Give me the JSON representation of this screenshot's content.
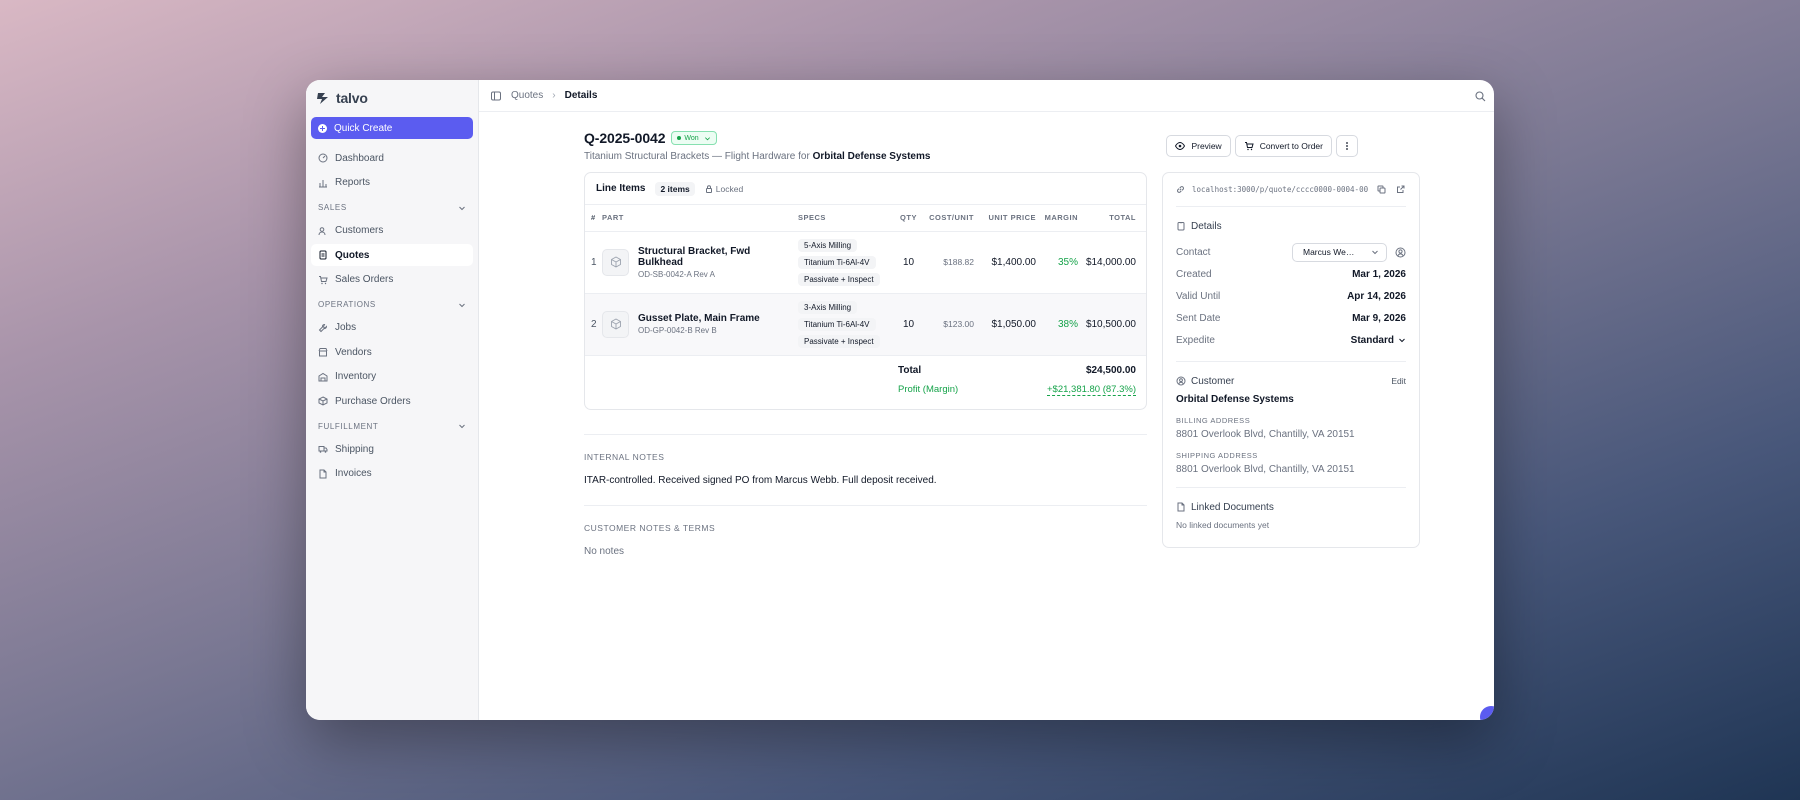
{
  "app": {
    "name": "talvo"
  },
  "sidebar": {
    "quick_create": "Quick Create",
    "top_items": [
      {
        "label": "Dashboard",
        "icon": "dashboard-icon"
      },
      {
        "label": "Reports",
        "icon": "bar-chart-icon"
      }
    ],
    "sections": [
      {
        "title": "SALES",
        "items": [
          {
            "label": "Customers",
            "icon": "users-icon"
          },
          {
            "label": "Quotes",
            "icon": "document-icon",
            "active": true
          },
          {
            "label": "Sales Orders",
            "icon": "cart-icon"
          }
        ]
      },
      {
        "title": "OPERATIONS",
        "items": [
          {
            "label": "Jobs",
            "icon": "wrench-icon"
          },
          {
            "label": "Vendors",
            "icon": "store-icon"
          },
          {
            "label": "Inventory",
            "icon": "warehouse-icon"
          },
          {
            "label": "Purchase Orders",
            "icon": "package-icon"
          }
        ]
      },
      {
        "title": "FULFILLMENT",
        "items": [
          {
            "label": "Shipping",
            "icon": "truck-icon"
          },
          {
            "label": "Invoices",
            "icon": "file-icon"
          }
        ]
      }
    ]
  },
  "breadcrumb": {
    "parent": "Quotes",
    "current": "Details"
  },
  "quote": {
    "id": "Q-2025-0042",
    "status": "Won",
    "subtitle_prefix": "Titanium Structural Brackets — Flight Hardware for",
    "customer": "Orbital Defense Systems"
  },
  "actions": {
    "preview": "Preview",
    "convert": "Convert to Order"
  },
  "line_items": {
    "title": "Line Items",
    "count": "2 items",
    "locked": "Locked",
    "columns": {
      "num": "#",
      "part": "PART",
      "specs": "SPECS",
      "qty": "QTY",
      "cost": "COST/UNIT",
      "unit": "UNIT PRICE",
      "margin": "MARGIN",
      "total": "TOTAL"
    },
    "rows": [
      {
        "num": "1",
        "name": "Structural Bracket, Fwd Bulkhead",
        "part_no": "OD-SB-0042-A Rev A",
        "specs": [
          "5-Axis Milling",
          "Titanium Ti-6Al-4V",
          "Passivate + Inspect"
        ],
        "qty": "10",
        "cost": "$188.82",
        "unit": "$1,400.00",
        "margin": "35%",
        "total": "$14,000.00"
      },
      {
        "num": "2",
        "name": "Gusset Plate, Main Frame",
        "part_no": "OD-GP-0042-B Rev B",
        "specs": [
          "3-Axis Milling",
          "Titanium Ti-6Al-4V",
          "Passivate + Inspect"
        ],
        "qty": "10",
        "cost": "$123.00",
        "unit": "$1,050.00",
        "margin": "38%",
        "total": "$10,500.00"
      }
    ],
    "total_label": "Total",
    "total_value": "$24,500.00",
    "profit_label": "Profit (Margin)",
    "profit_value": "+$21,381.80 (87.3%)"
  },
  "internal_notes": {
    "label": "INTERNAL NOTES",
    "text": "ITAR-controlled. Received signed PO from Marcus Webb. Full deposit received."
  },
  "customer_notes": {
    "label": "CUSTOMER NOTES & TERMS",
    "text": "No notes"
  },
  "panel": {
    "url": "localhost:3000/p/quote/cccc0000-0004-00…",
    "details_title": "Details",
    "contact_label": "Contact",
    "contact_value": "Marcus We…",
    "created_label": "Created",
    "created_value": "Mar 1, 2026",
    "valid_label": "Valid Until",
    "valid_value": "Apr 14, 2026",
    "sent_label": "Sent Date",
    "sent_value": "Mar 9, 2026",
    "expedite_label": "Expedite",
    "expedite_value": "Standard",
    "customer_title": "Customer",
    "edit": "Edit",
    "customer_name": "Orbital Defense Systems",
    "billing_label": "BILLING ADDRESS",
    "billing_value": "8801 Overlook Blvd, Chantilly, VA 20151",
    "shipping_label": "SHIPPING ADDRESS",
    "shipping_value": "8801 Overlook Blvd, Chantilly, VA 20151",
    "docs_title": "Linked Documents",
    "docs_empty": "No linked documents yet"
  },
  "colors": {
    "accent": "#5b5cf0",
    "success": "#16a34a"
  }
}
